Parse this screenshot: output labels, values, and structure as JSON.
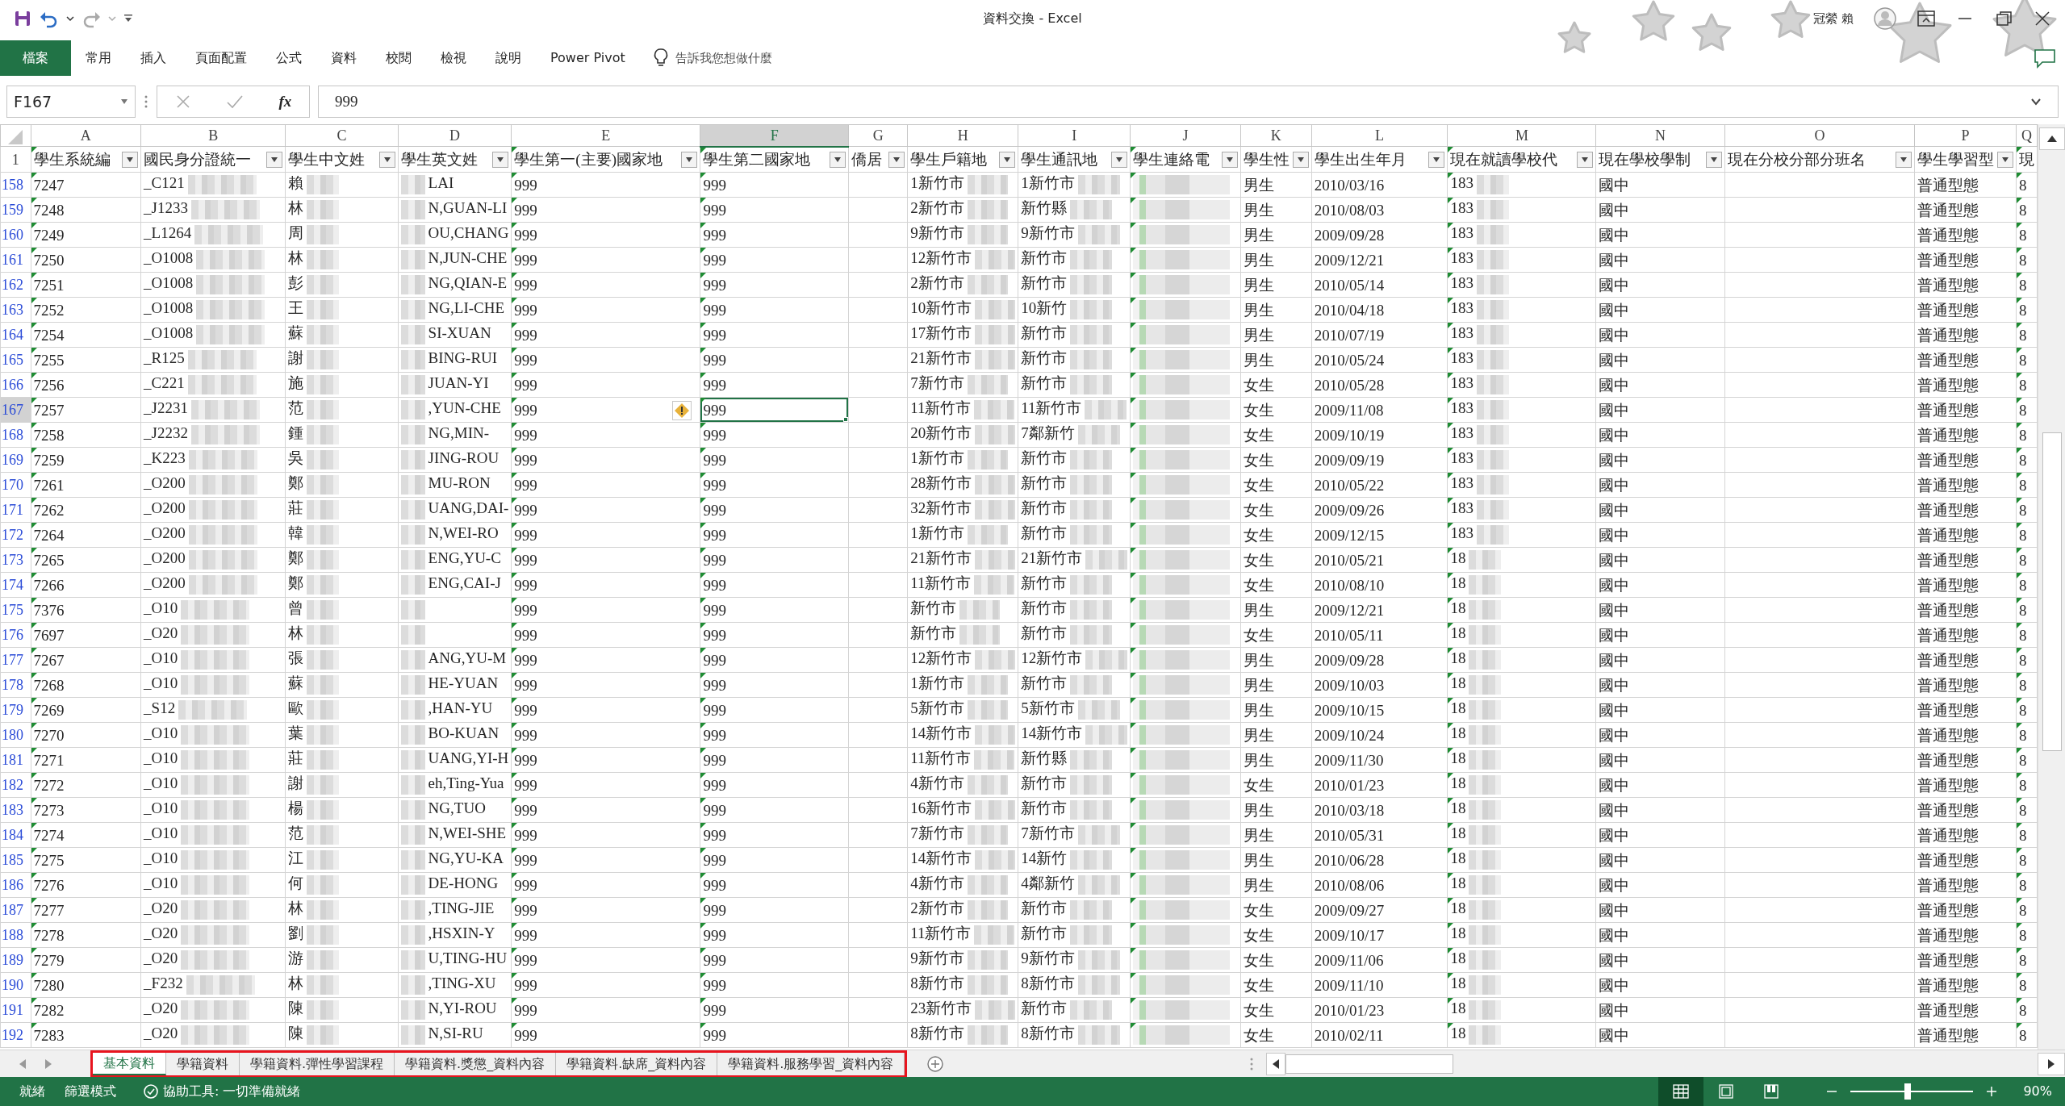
{
  "window": {
    "title": "資料交換  -  Excel",
    "user": "冠縈 賴"
  },
  "ribbon": {
    "tabs": [
      {
        "label": "檔案",
        "kind": "file",
        "selected": false
      },
      {
        "label": "常用",
        "kind": "tab",
        "selected": false
      },
      {
        "label": "插入",
        "kind": "tab",
        "selected": false
      },
      {
        "label": "頁面配置",
        "kind": "tab",
        "selected": false
      },
      {
        "label": "公式",
        "kind": "tab",
        "selected": false
      },
      {
        "label": "資料",
        "kind": "tab",
        "selected": false
      },
      {
        "label": "校閱",
        "kind": "tab",
        "selected": false
      },
      {
        "label": "檢視",
        "kind": "tab",
        "selected": false
      },
      {
        "label": "說明",
        "kind": "tab",
        "selected": false
      },
      {
        "label": "Power Pivot",
        "kind": "tab",
        "selected": false
      }
    ],
    "tell_me": "告訴我您想做什麼"
  },
  "formula_bar": {
    "name_box": "F167",
    "fx": "fx",
    "value": "999"
  },
  "sheet": {
    "columns": [
      {
        "letter": "A",
        "header": "學生系統編",
        "selected": false,
        "filter": true,
        "text_flag": true
      },
      {
        "letter": "B",
        "header": "國民身分證統一",
        "selected": false,
        "filter": true,
        "text_flag": false,
        "blurred_after": true
      },
      {
        "letter": "C",
        "header": "學生中文姓",
        "selected": false,
        "filter": true,
        "text_flag": false,
        "blurred_after": true
      },
      {
        "letter": "D",
        "header": "學生英文姓",
        "selected": false,
        "filter": true,
        "text_flag": false,
        "blurred_before": true
      },
      {
        "letter": "E",
        "header": "學生第一(主要)國家地",
        "selected": false,
        "filter": true,
        "text_flag": true
      },
      {
        "letter": "F",
        "header": "學生第二國家地",
        "selected": true,
        "filter": true,
        "text_flag": true
      },
      {
        "letter": "G",
        "header": "僑居",
        "selected": false,
        "filter": true,
        "text_flag": false
      },
      {
        "letter": "H",
        "header": "學生戶籍地",
        "selected": false,
        "filter": true,
        "text_flag": false,
        "blurred_after": true
      },
      {
        "letter": "I",
        "header": "學生通訊地",
        "selected": false,
        "filter": true,
        "text_flag": false,
        "blurred_after": true
      },
      {
        "letter": "J",
        "header": "學生連絡電",
        "selected": false,
        "filter": true,
        "text_flag": true,
        "blurred_after": true
      },
      {
        "letter": "K",
        "header": "學生性",
        "selected": false,
        "filter": true,
        "text_flag": false
      },
      {
        "letter": "L",
        "header": "學生出生年月",
        "selected": false,
        "filter": true,
        "text_flag": false
      },
      {
        "letter": "M",
        "header": "現在就讀學校代",
        "selected": false,
        "filter": true,
        "text_flag": true,
        "blurred_after": true
      },
      {
        "letter": "N",
        "header": "現在學校學制",
        "selected": false,
        "filter": true,
        "text_flag": false
      },
      {
        "letter": "O",
        "header": "現在分校分部分班名",
        "selected": false,
        "filter": true,
        "text_flag": false
      },
      {
        "letter": "P",
        "header": "學生學習型",
        "selected": false,
        "filter": true,
        "text_flag": false
      },
      {
        "letter": "Q",
        "header": "現",
        "selected": false,
        "filter": false,
        "text_flag": true
      }
    ],
    "header_row": "1",
    "rows": [
      {
        "number": "158",
        "selected": false,
        "warning": false,
        "cells": {
          "A": "7247",
          "B": "_C121",
          "C": "賴",
          "D": "LAI",
          "E": "999",
          "F": "999",
          "H": "1新竹市",
          "I": "1新竹市",
          "K": "男生",
          "L": "2010/03/16",
          "M": "183",
          "N": "國中",
          "P": "普通型態",
          "Q": "8"
        }
      },
      {
        "number": "159",
        "selected": false,
        "warning": false,
        "cells": {
          "A": "7248",
          "B": "_J1233",
          "C": "林",
          "D": "N,GUAN-LI",
          "E": "999",
          "F": "999",
          "H": "2新竹市",
          "I": "新竹縣",
          "K": "男生",
          "L": "2010/08/03",
          "M": "183",
          "N": "國中",
          "P": "普通型態",
          "Q": "8"
        }
      },
      {
        "number": "160",
        "selected": false,
        "warning": false,
        "cells": {
          "A": "7249",
          "B": "_L1264",
          "C": "周",
          "D": "OU,CHANG",
          "E": "999",
          "F": "999",
          "H": "9新竹市",
          "I": "9新竹市",
          "K": "男生",
          "L": "2009/09/28",
          "M": "183",
          "N": "國中",
          "P": "普通型態",
          "Q": "8"
        }
      },
      {
        "number": "161",
        "selected": false,
        "warning": false,
        "cells": {
          "A": "7250",
          "B": "_O1008",
          "C": "林",
          "D": "N,JUN-CHE",
          "E": "999",
          "F": "999",
          "H": "12新竹市",
          "I": "新竹市",
          "K": "男生",
          "L": "2009/12/21",
          "M": "183",
          "N": "國中",
          "P": "普通型態",
          "Q": "8"
        }
      },
      {
        "number": "162",
        "selected": false,
        "warning": false,
        "cells": {
          "A": "7251",
          "B": "_O1008",
          "C": "彭",
          "D": "NG,QIAN-E",
          "E": "999",
          "F": "999",
          "H": "2新竹市",
          "I": "新竹市",
          "K": "男生",
          "L": "2010/05/14",
          "M": "183",
          "N": "國中",
          "P": "普通型態",
          "Q": "8"
        }
      },
      {
        "number": "163",
        "selected": false,
        "warning": false,
        "cells": {
          "A": "7252",
          "B": "_O1008",
          "C": "王",
          "D": "NG,LI-CHE",
          "E": "999",
          "F": "999",
          "H": "10新竹市",
          "I": "10新竹",
          "K": "男生",
          "L": "2010/04/18",
          "M": "183",
          "N": "國中",
          "P": "普通型態",
          "Q": "8"
        }
      },
      {
        "number": "164",
        "selected": false,
        "warning": false,
        "cells": {
          "A": "7254",
          "B": "_O1008",
          "C": "蘇",
          "D": "SI-XUAN",
          "E": "999",
          "F": "999",
          "H": "17新竹市",
          "I": "新竹市",
          "K": "男生",
          "L": "2010/07/19",
          "M": "183",
          "N": "國中",
          "P": "普通型態",
          "Q": "8"
        }
      },
      {
        "number": "165",
        "selected": false,
        "warning": false,
        "cells": {
          "A": "7255",
          "B": "_R125",
          "C": "謝",
          "D": "BING-RUI",
          "E": "999",
          "F": "999",
          "H": "21新竹市",
          "I": "新竹市",
          "K": "男生",
          "L": "2010/05/24",
          "M": "183",
          "N": "國中",
          "P": "普通型態",
          "Q": "8"
        }
      },
      {
        "number": "166",
        "selected": false,
        "warning": false,
        "cells": {
          "A": "7256",
          "B": "_C221",
          "C": "施",
          "D": "JUAN-YI",
          "E": "999",
          "F": "999",
          "H": "7新竹市",
          "I": "新竹市",
          "K": "女生",
          "L": "2010/05/28",
          "M": "183",
          "N": "國中",
          "P": "普通型態",
          "Q": "8"
        }
      },
      {
        "number": "167",
        "selected": true,
        "warning": true,
        "cells": {
          "A": "7257",
          "B": "_J2231",
          "C": "范",
          "D": ",YUN-CHE",
          "E": "999",
          "F": "999",
          "H": "11新竹市",
          "I": "11新竹市",
          "K": "女生",
          "L": "2009/11/08",
          "M": "183",
          "N": "國中",
          "P": "普通型態",
          "Q": "8"
        }
      },
      {
        "number": "168",
        "selected": false,
        "warning": false,
        "cells": {
          "A": "7258",
          "B": "_J2232",
          "C": "鍾",
          "D": "NG,MIN-",
          "E": "999",
          "F": "999",
          "H": "20新竹市",
          "I": "7鄰新竹",
          "K": "女生",
          "L": "2009/10/19",
          "M": "183",
          "N": "國中",
          "P": "普通型態",
          "Q": "8"
        }
      },
      {
        "number": "169",
        "selected": false,
        "warning": false,
        "cells": {
          "A": "7259",
          "B": "_K223",
          "C": "吳",
          "D": "JING-ROU",
          "E": "999",
          "F": "999",
          "H": "1新竹市",
          "I": "新竹市",
          "K": "女生",
          "L": "2009/09/19",
          "M": "183",
          "N": "國中",
          "P": "普通型態",
          "Q": "8"
        }
      },
      {
        "number": "170",
        "selected": false,
        "warning": false,
        "cells": {
          "A": "7261",
          "B": "_O200",
          "C": "鄭",
          "D": "MU-RON",
          "E": "999",
          "F": "999",
          "H": "28新竹市",
          "I": "新竹市",
          "K": "女生",
          "L": "2010/05/22",
          "M": "183",
          "N": "國中",
          "P": "普通型態",
          "Q": "8"
        }
      },
      {
        "number": "171",
        "selected": false,
        "warning": false,
        "cells": {
          "A": "7262",
          "B": "_O200",
          "C": "莊",
          "D": "UANG,DAI-",
          "E": "999",
          "F": "999",
          "H": "32新竹市",
          "I": "新竹市",
          "K": "女生",
          "L": "2009/09/26",
          "M": "183",
          "N": "國中",
          "P": "普通型態",
          "Q": "8"
        }
      },
      {
        "number": "172",
        "selected": false,
        "warning": false,
        "cells": {
          "A": "7264",
          "B": "_O200",
          "C": "韓",
          "D": "N,WEI-RO",
          "E": "999",
          "F": "999",
          "H": "1新竹市",
          "I": "新竹市",
          "K": "女生",
          "L": "2009/12/15",
          "M": "183",
          "N": "國中",
          "P": "普通型態",
          "Q": "8"
        }
      },
      {
        "number": "173",
        "selected": false,
        "warning": false,
        "cells": {
          "A": "7265",
          "B": "_O200",
          "C": "鄭",
          "D": "ENG,YU-C",
          "E": "999",
          "F": "999",
          "H": "21新竹市",
          "I": "21新竹市",
          "K": "女生",
          "L": "2010/05/21",
          "M": "18",
          "N": "國中",
          "P": "普通型態",
          "Q": "8"
        }
      },
      {
        "number": "174",
        "selected": false,
        "warning": false,
        "cells": {
          "A": "7266",
          "B": "_O200",
          "C": "鄭",
          "D": "ENG,CAI-J",
          "E": "999",
          "F": "999",
          "H": "11新竹市",
          "I": "新竹市",
          "K": "女生",
          "L": "2010/08/10",
          "M": "18",
          "N": "國中",
          "P": "普通型態",
          "Q": "8"
        }
      },
      {
        "number": "175",
        "selected": false,
        "warning": false,
        "cells": {
          "A": "7376",
          "B": "_O10",
          "C": "曾",
          "E": "999",
          "F": "999",
          "H": "新竹市",
          "I": "新竹市",
          "K": "男生",
          "L": "2009/12/21",
          "M": "18",
          "N": "國中",
          "P": "普通型態",
          "Q": "8"
        }
      },
      {
        "number": "176",
        "selected": false,
        "warning": false,
        "cells": {
          "A": "7697",
          "B": "_O20",
          "C": "林",
          "E": "999",
          "F": "999",
          "H": "新竹市",
          "I": "新竹市",
          "K": "女生",
          "L": "2010/05/11",
          "M": "18",
          "N": "國中",
          "P": "普通型態",
          "Q": "8"
        }
      },
      {
        "number": "177",
        "selected": false,
        "warning": false,
        "cells": {
          "A": "7267",
          "B": "_O10",
          "C": "張",
          "D": "ANG,YU-M",
          "E": "999",
          "F": "999",
          "H": "12新竹市",
          "I": "12新竹市",
          "K": "男生",
          "L": "2009/09/28",
          "M": "18",
          "N": "國中",
          "P": "普通型態",
          "Q": "8"
        }
      },
      {
        "number": "178",
        "selected": false,
        "warning": false,
        "cells": {
          "A": "7268",
          "B": "_O10",
          "C": "蘇",
          "D": "HE-YUAN",
          "E": "999",
          "F": "999",
          "H": "1新竹市",
          "I": "新竹市",
          "K": "男生",
          "L": "2009/10/03",
          "M": "18",
          "N": "國中",
          "P": "普通型態",
          "Q": "8"
        }
      },
      {
        "number": "179",
        "selected": false,
        "warning": false,
        "cells": {
          "A": "7269",
          "B": "_S12",
          "C": "歐",
          "D": ",HAN-YU",
          "E": "999",
          "F": "999",
          "H": "5新竹市",
          "I": "5新竹市",
          "K": "男生",
          "L": "2009/10/15",
          "M": "18",
          "N": "國中",
          "P": "普通型態",
          "Q": "8"
        }
      },
      {
        "number": "180",
        "selected": false,
        "warning": false,
        "cells": {
          "A": "7270",
          "B": "_O10",
          "C": "葉",
          "D": "BO-KUAN",
          "E": "999",
          "F": "999",
          "H": "14新竹市",
          "I": "14新竹市",
          "K": "男生",
          "L": "2009/10/24",
          "M": "18",
          "N": "國中",
          "P": "普通型態",
          "Q": "8"
        }
      },
      {
        "number": "181",
        "selected": false,
        "warning": false,
        "cells": {
          "A": "7271",
          "B": "_O10",
          "C": "莊",
          "D": "UANG,YI-H",
          "E": "999",
          "F": "999",
          "H": "11新竹市",
          "I": "新竹縣",
          "K": "男生",
          "L": "2009/11/30",
          "M": "18",
          "N": "國中",
          "P": "普通型態",
          "Q": "8"
        }
      },
      {
        "number": "182",
        "selected": false,
        "warning": false,
        "cells": {
          "A": "7272",
          "B": "_O10",
          "C": "謝",
          "D": "eh,Ting-Yua",
          "E": "999",
          "F": "999",
          "H": "4新竹市",
          "I": "新竹市",
          "K": "女生",
          "L": "2010/01/23",
          "M": "18",
          "N": "國中",
          "P": "普通型態",
          "Q": "8"
        }
      },
      {
        "number": "183",
        "selected": false,
        "warning": false,
        "cells": {
          "A": "7273",
          "B": "_O10",
          "C": "楊",
          "D": "NG,TUO",
          "E": "999",
          "F": "999",
          "H": "16新竹市",
          "I": "新竹市",
          "K": "男生",
          "L": "2010/03/18",
          "M": "18",
          "N": "國中",
          "P": "普通型態",
          "Q": "8"
        }
      },
      {
        "number": "184",
        "selected": false,
        "warning": false,
        "cells": {
          "A": "7274",
          "B": "_O10",
          "C": "范",
          "D": "N,WEI-SHE",
          "E": "999",
          "F": "999",
          "H": "7新竹市",
          "I": "7新竹市",
          "K": "男生",
          "L": "2010/05/31",
          "M": "18",
          "N": "國中",
          "P": "普通型態",
          "Q": "8"
        }
      },
      {
        "number": "185",
        "selected": false,
        "warning": false,
        "cells": {
          "A": "7275",
          "B": "_O10",
          "C": "江",
          "D": "NG,YU-KA",
          "E": "999",
          "F": "999",
          "H": "14新竹市",
          "I": "14新竹",
          "K": "男生",
          "L": "2010/06/28",
          "M": "18",
          "N": "國中",
          "P": "普通型態",
          "Q": "8"
        }
      },
      {
        "number": "186",
        "selected": false,
        "warning": false,
        "cells": {
          "A": "7276",
          "B": "_O10",
          "C": "何",
          "D": "DE-HONG",
          "E": "999",
          "F": "999",
          "H": "4新竹市",
          "I": "4鄰新竹",
          "K": "男生",
          "L": "2010/08/06",
          "M": "18",
          "N": "國中",
          "P": "普通型態",
          "Q": "8"
        }
      },
      {
        "number": "187",
        "selected": false,
        "warning": false,
        "cells": {
          "A": "7277",
          "B": "_O20",
          "C": "林",
          "D": ",TING-JIE",
          "E": "999",
          "F": "999",
          "H": "2新竹市",
          "I": "新竹市",
          "K": "女生",
          "L": "2009/09/27",
          "M": "18",
          "N": "國中",
          "P": "普通型態",
          "Q": "8"
        }
      },
      {
        "number": "188",
        "selected": false,
        "warning": false,
        "cells": {
          "A": "7278",
          "B": "_O20",
          "C": "劉",
          "D": ",HSXIN-Y",
          "E": "999",
          "F": "999",
          "H": "11新竹市",
          "I": "新竹市",
          "K": "女生",
          "L": "2009/10/17",
          "M": "18",
          "N": "國中",
          "P": "普通型態",
          "Q": "8"
        }
      },
      {
        "number": "189",
        "selected": false,
        "warning": false,
        "cells": {
          "A": "7279",
          "B": "_O20",
          "C": "游",
          "D": "U,TING-HU",
          "E": "999",
          "F": "999",
          "H": "9新竹市",
          "I": "9新竹市",
          "K": "女生",
          "L": "2009/11/06",
          "M": "18",
          "N": "國中",
          "P": "普通型態",
          "Q": "8"
        }
      },
      {
        "number": "190",
        "selected": false,
        "warning": false,
        "cells": {
          "A": "7280",
          "B": "_F232",
          "C": "林",
          "D": ",TING-XU",
          "E": "999",
          "F": "999",
          "H": "8新竹市",
          "I": "8新竹市",
          "K": "女生",
          "L": "2009/11/10",
          "M": "18",
          "N": "國中",
          "P": "普通型態",
          "Q": "8"
        }
      },
      {
        "number": "191",
        "selected": false,
        "warning": false,
        "cells": {
          "A": "7282",
          "B": "_O20",
          "C": "陳",
          "D": "N,YI-ROU",
          "E": "999",
          "F": "999",
          "H": "23新竹市",
          "I": "新竹市",
          "K": "女生",
          "L": "2010/01/23",
          "M": "18",
          "N": "國中",
          "P": "普通型態",
          "Q": "8"
        }
      },
      {
        "number": "192",
        "selected": false,
        "warning": false,
        "cells": {
          "A": "7283",
          "B": "_O20",
          "C": "陳",
          "D": "N,SI-RU",
          "E": "999",
          "F": "999",
          "H": "8新竹市",
          "I": "8新竹市",
          "K": "女生",
          "L": "2010/02/11",
          "M": "18",
          "N": "國中",
          "P": "普通型態",
          "Q": "8"
        }
      }
    ]
  },
  "sheet_tabs": [
    {
      "label": "基本資料",
      "selected": true
    },
    {
      "label": "學籍資料",
      "selected": false
    },
    {
      "label": "學籍資料.彈性學習課程",
      "selected": false
    },
    {
      "label": "學籍資料.獎懲_資料內容",
      "selected": false
    },
    {
      "label": "學籍資料.缺席_資料內容",
      "selected": false
    },
    {
      "label": "學籍資料.服務學習_資料內容",
      "selected": false
    }
  ],
  "status_bar": {
    "items": [
      "就緒",
      "篩選模式"
    ],
    "accessibility": "協助工具: 一切準備就緒",
    "views": [
      {
        "kind": "normal",
        "selected": true
      },
      {
        "kind": "page_layout",
        "selected": false
      },
      {
        "kind": "page_break",
        "selected": false
      }
    ],
    "zoom": {
      "level": 0.44,
      "reading": "90%"
    }
  }
}
